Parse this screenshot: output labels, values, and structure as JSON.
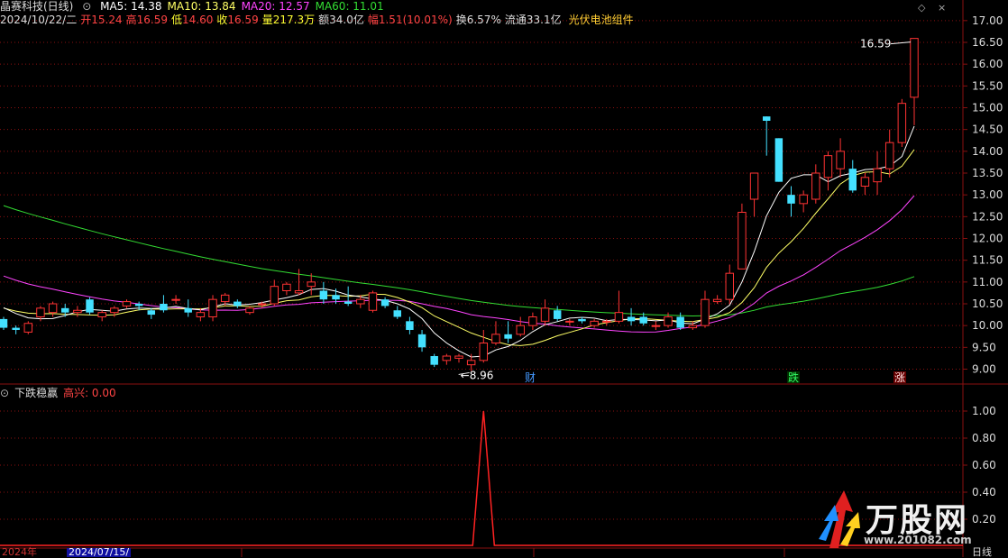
{
  "stock": {
    "name": "晶赛科技(日线)",
    "date": "2024/10/22/二"
  },
  "ma": [
    {
      "label": "MA5: 14.38",
      "color": "#ffffff"
    },
    {
      "label": "MA10: 13.84",
      "color": "#ffff66"
    },
    {
      "label": "MA20: 12.57",
      "color": "#ff44ff"
    },
    {
      "label": "MA60: 11.01",
      "color": "#33dd33"
    }
  ],
  "quote": [
    {
      "k": "开",
      "v": "15.24",
      "kc": "#ff4444",
      "vc": "#ff4444"
    },
    {
      "k": "高",
      "v": "16.59",
      "kc": "#ff4444",
      "vc": "#ff4444"
    },
    {
      "k": "低",
      "v": "14.60",
      "kc": "#ffff33",
      "vc": "#ff4444"
    },
    {
      "k": "收",
      "v": "16.59",
      "kc": "#ffff33",
      "vc": "#ff4444"
    },
    {
      "k": "量",
      "v": "217.3万",
      "kc": "#ffff33",
      "vc": "#ffff33"
    },
    {
      "k": "额",
      "v": "34.0亿",
      "kc": "#dddddd",
      "vc": "#dddddd"
    },
    {
      "k": "幅",
      "v": "1.51(10.01%)",
      "kc": "#ff4444",
      "vc": "#ff4444"
    },
    {
      "k": "换",
      "v": "6.57%",
      "kc": "#dddddd",
      "vc": "#dddddd"
    },
    {
      "k": "流通",
      "v": "33.1亿",
      "kc": "#dddddd",
      "vc": "#dddddd"
    }
  ],
  "sector": "光伏电池组件",
  "indicator": {
    "name": "下跌稳赢",
    "value_label": "高兴: 0.00"
  },
  "price_axis": [
    "17.00",
    "16.50",
    "16.00",
    "15.50",
    "15.00",
    "14.50",
    "14.00",
    "13.50",
    "13.00",
    "12.50",
    "12.00",
    "11.50",
    "11.00",
    "10.50",
    "10.00",
    "9.50",
    "9.00"
  ],
  "ind_axis": [
    "1.00",
    "0.80",
    "0.60",
    "0.40",
    "0.20"
  ],
  "annotations": {
    "high": "16.59",
    "low": "8.96",
    "cai": "财",
    "die": "跌",
    "zhang": "涨"
  },
  "footer": {
    "left": "2024年",
    "date": "2024/07/15/",
    "right": "日线"
  },
  "watermark": {
    "text": "万股网",
    "url": "www.201082.com"
  },
  "colors": {
    "up": "#ff3333",
    "down": "#44e0ff",
    "ma5": "#ffffff",
    "ma10": "#ffff66",
    "ma20": "#ff44ff",
    "ma60": "#33dd33",
    "grid": "#8a1010"
  },
  "chart_data": {
    "type": "candlestick",
    "ylim": [
      8.7,
      17.1
    ],
    "candles": [
      [
        10.15,
        9.95,
        10.2,
        9.9
      ],
      [
        9.95,
        9.9,
        10.0,
        9.8
      ],
      [
        9.85,
        10.05,
        10.1,
        9.8
      ],
      [
        10.2,
        10.4,
        10.45,
        10.1
      ],
      [
        10.3,
        10.5,
        10.55,
        10.2
      ],
      [
        10.4,
        10.3,
        10.5,
        10.2
      ],
      [
        10.3,
        10.35,
        10.45,
        10.2
      ],
      [
        10.6,
        10.3,
        10.65,
        10.25
      ],
      [
        10.2,
        10.3,
        10.35,
        10.1
      ],
      [
        10.3,
        10.4,
        10.45,
        10.2
      ],
      [
        10.45,
        10.55,
        10.6,
        10.4
      ],
      [
        10.5,
        10.45,
        10.55,
        10.35
      ],
      [
        10.35,
        10.25,
        10.4,
        10.15
      ],
      [
        10.5,
        10.35,
        10.7,
        10.3
      ],
      [
        10.6,
        10.6,
        10.7,
        10.5
      ],
      [
        10.4,
        10.3,
        10.6,
        10.2
      ],
      [
        10.2,
        10.3,
        10.4,
        10.1
      ],
      [
        10.2,
        10.6,
        10.7,
        10.1
      ],
      [
        10.55,
        10.7,
        10.75,
        10.45
      ],
      [
        10.55,
        10.45,
        10.6,
        10.4
      ],
      [
        10.3,
        10.4,
        10.45,
        10.25
      ],
      [
        10.5,
        10.5,
        10.55,
        10.4
      ],
      [
        10.5,
        10.9,
        11.05,
        10.45
      ],
      [
        10.8,
        10.95,
        11.0,
        10.7
      ],
      [
        10.75,
        10.8,
        11.3,
        10.7
      ],
      [
        10.9,
        11.0,
        11.2,
        10.7
      ],
      [
        10.8,
        10.6,
        11.0,
        10.5
      ],
      [
        10.7,
        10.6,
        10.85,
        10.5
      ],
      [
        10.55,
        10.5,
        10.9,
        10.45
      ],
      [
        10.5,
        10.6,
        10.7,
        10.4
      ],
      [
        10.35,
        10.75,
        10.8,
        10.3
      ],
      [
        10.6,
        10.45,
        10.65,
        10.4
      ],
      [
        10.35,
        10.2,
        10.45,
        10.15
      ],
      [
        10.1,
        9.9,
        10.2,
        9.8
      ],
      [
        9.8,
        9.5,
        9.9,
        9.4
      ],
      [
        9.3,
        9.1,
        9.35,
        9.05
      ],
      [
        9.2,
        9.3,
        9.35,
        9.1
      ],
      [
        9.25,
        9.3,
        9.35,
        9.15
      ],
      [
        9.1,
        9.2,
        9.35,
        8.96
      ],
      [
        9.2,
        9.6,
        9.9,
        9.15
      ],
      [
        9.6,
        9.8,
        10.1,
        9.55
      ],
      [
        9.8,
        9.7,
        10.1,
        9.6
      ],
      [
        9.8,
        10.0,
        10.2,
        9.75
      ],
      [
        10.0,
        10.2,
        10.3,
        9.9
      ],
      [
        10.1,
        10.4,
        10.6,
        10.0
      ],
      [
        10.35,
        10.15,
        10.45,
        10.1
      ],
      [
        10.1,
        10.1,
        10.15,
        10.0
      ],
      [
        10.15,
        10.1,
        10.2,
        10.05
      ],
      [
        10.0,
        10.1,
        10.15,
        9.95
      ],
      [
        10.1,
        10.1,
        10.15,
        10.0
      ],
      [
        10.1,
        10.3,
        10.8,
        10.05
      ],
      [
        10.2,
        10.1,
        10.4,
        10.0
      ],
      [
        10.2,
        10.05,
        10.3,
        10.0
      ],
      [
        10.0,
        10.0,
        10.1,
        9.9
      ],
      [
        10.0,
        10.2,
        10.3,
        9.95
      ],
      [
        10.2,
        9.95,
        10.3,
        9.9
      ],
      [
        9.95,
        10.0,
        10.1,
        9.9
      ],
      [
        10.0,
        10.6,
        10.8,
        9.95
      ],
      [
        10.55,
        10.6,
        10.7,
        10.5
      ],
      [
        10.6,
        11.2,
        11.4,
        10.5
      ],
      [
        11.3,
        12.6,
        12.8,
        11.3
      ],
      [
        12.9,
        13.5,
        13.5,
        12.5
      ],
      [
        14.8,
        14.7,
        14.8,
        13.9
      ],
      [
        14.3,
        13.3,
        14.3,
        13.3
      ],
      [
        13.0,
        12.8,
        13.2,
        12.5
      ],
      [
        12.8,
        13.0,
        13.1,
        12.6
      ],
      [
        12.9,
        13.5,
        13.7,
        12.8
      ],
      [
        13.4,
        13.9,
        14.0,
        13.1
      ],
      [
        13.6,
        14.0,
        14.3,
        13.4
      ],
      [
        13.6,
        13.1,
        13.8,
        13.05
      ],
      [
        13.2,
        13.4,
        13.5,
        13.0
      ],
      [
        13.3,
        13.6,
        14.0,
        13.0
      ],
      [
        13.6,
        14.2,
        14.5,
        13.4
      ],
      [
        14.2,
        15.1,
        15.2,
        14.1
      ],
      [
        15.24,
        16.59,
        16.59,
        14.6
      ]
    ],
    "signal_index": 39,
    "indicator_ylim": [
      0,
      1.08
    ]
  }
}
